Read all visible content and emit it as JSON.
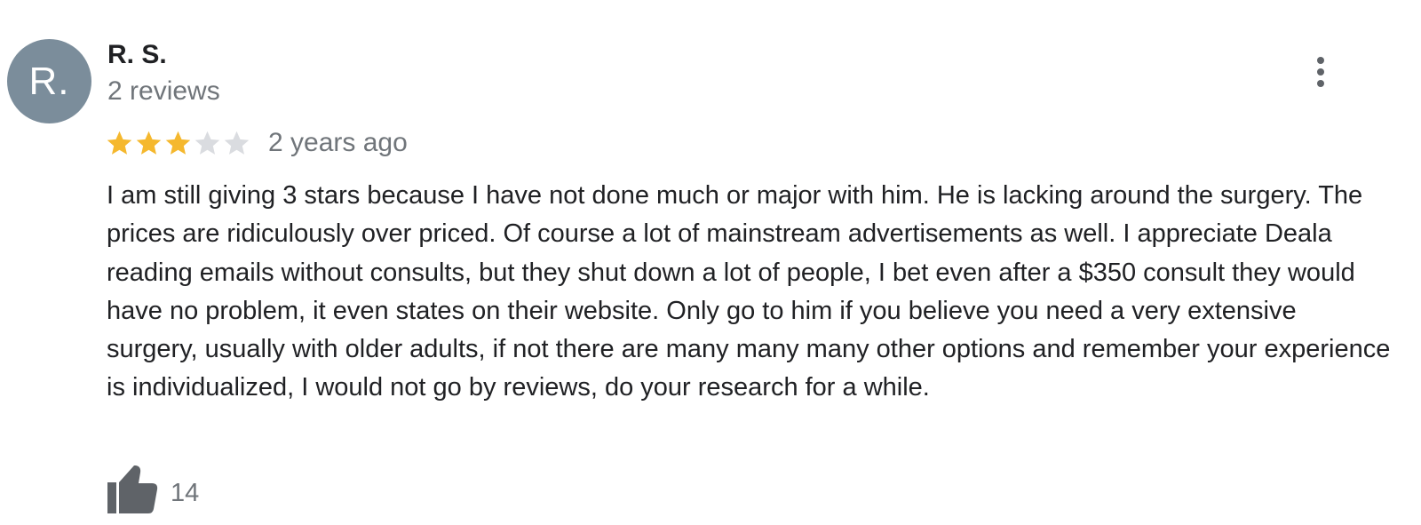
{
  "review": {
    "author": {
      "initials": "R.",
      "name": "R. S.",
      "review_count": "2 reviews",
      "avatar_color": "#7b8d9b"
    },
    "rating": {
      "value": 3,
      "max": 5,
      "filled_color": "#f5b82e",
      "empty_color": "#dadce0"
    },
    "date": "2 years ago",
    "text": "I am still giving 3 stars because I have not done much or major with him. He is lacking around the surgery. The prices are ridiculously over priced. Of course a lot of mainstream advertisements as well. I appreciate Deala reading emails without consults, but they shut down a lot of people, I bet even after a $350 consult they would have no problem, it even states on their website. Only go to him if you believe you need a very extensive surgery, usually with older adults, if not there are many many many other options and remember your experience is individualized, I would not go by reviews, do your research for a while.",
    "likes": "14",
    "icons": {
      "menu": "more-vert-icon",
      "like": "thumb-up-icon",
      "star": "star-icon"
    }
  }
}
